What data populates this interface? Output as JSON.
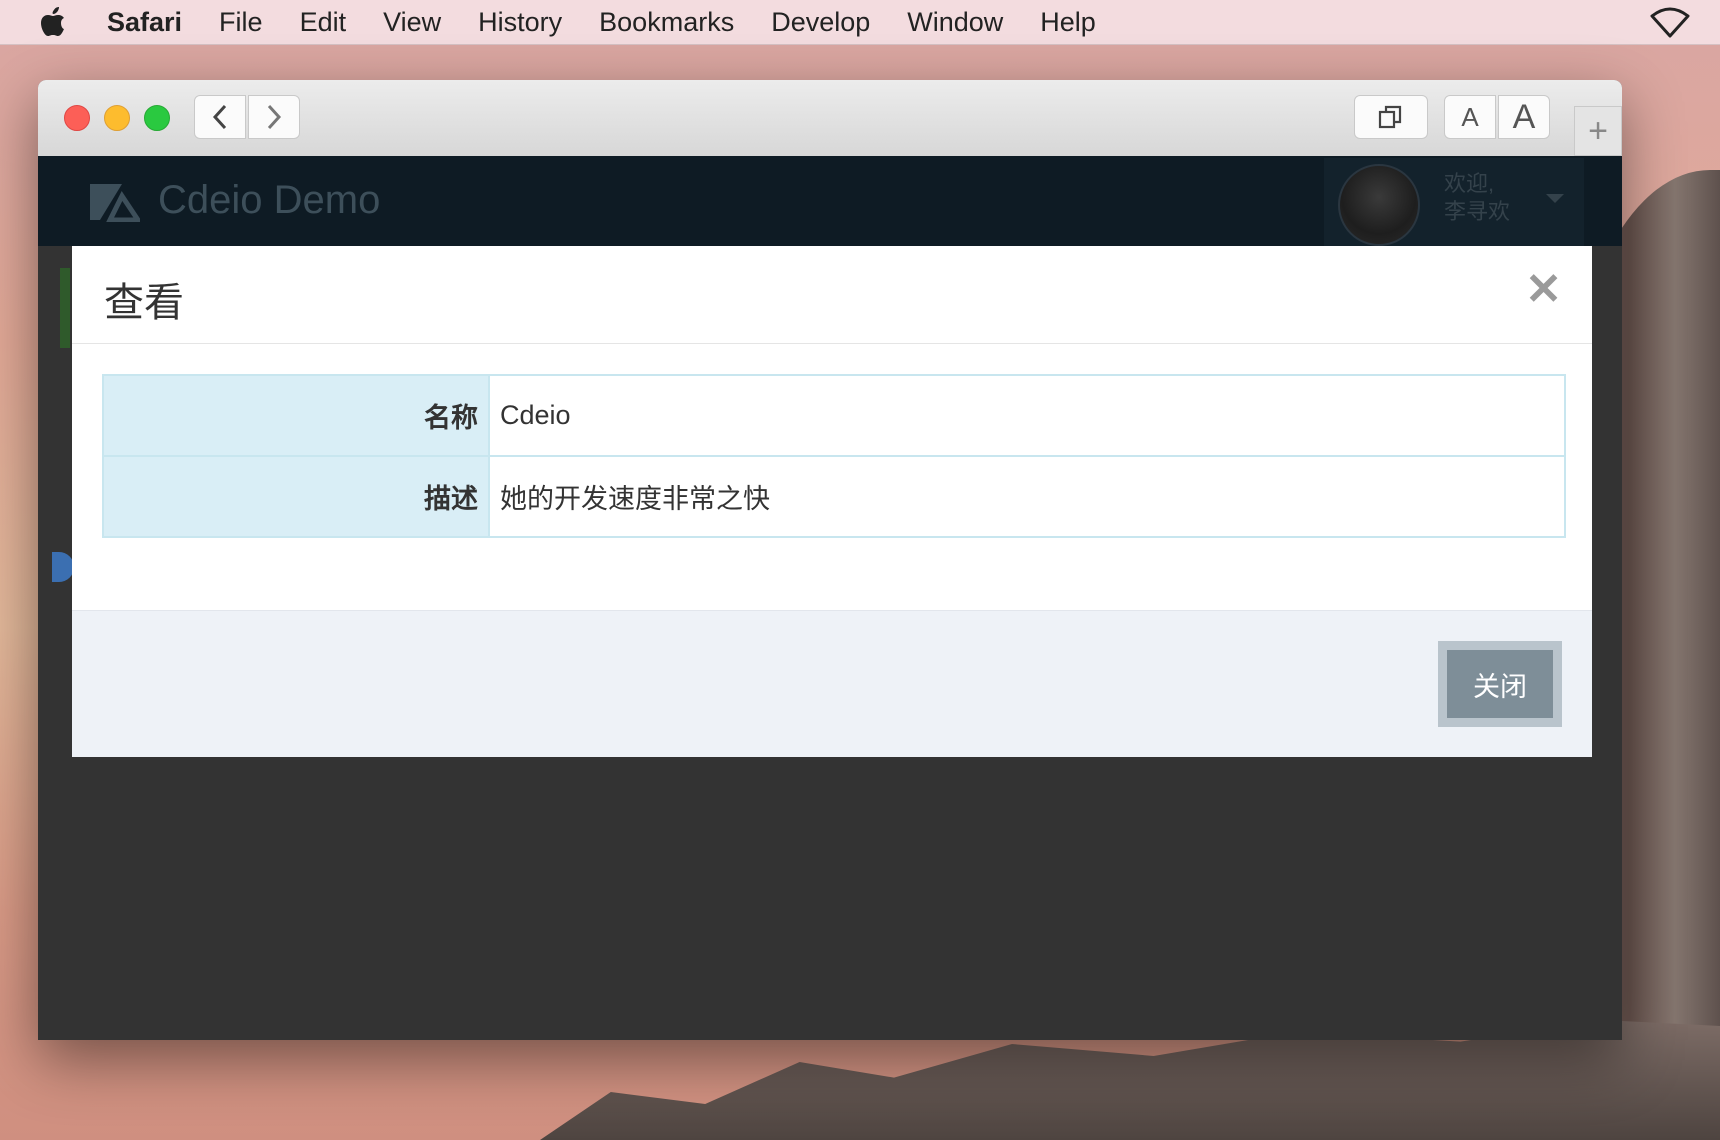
{
  "menubar": {
    "app": "Safari",
    "items": [
      "File",
      "Edit",
      "View",
      "History",
      "Bookmarks",
      "Develop",
      "Window",
      "Help"
    ]
  },
  "toolbar": {
    "font_small": "A",
    "font_large": "A",
    "new_tab": "+"
  },
  "app": {
    "title": "Cdeio Demo",
    "welcome": "欢迎,",
    "user_name": "李寻欢"
  },
  "modal": {
    "title": "查看",
    "close_symbol": "✕",
    "rows": [
      {
        "label": "名称",
        "value": "Cdeio"
      },
      {
        "label": "描述",
        "value": "她的开发速度非常之快"
      }
    ],
    "close_button": "关闭"
  },
  "colors": {
    "header_bg": "#0e1b24",
    "label_bg": "#d9eef6",
    "footer_bg": "#eef2f7",
    "button_bg": "#7e8e98"
  }
}
